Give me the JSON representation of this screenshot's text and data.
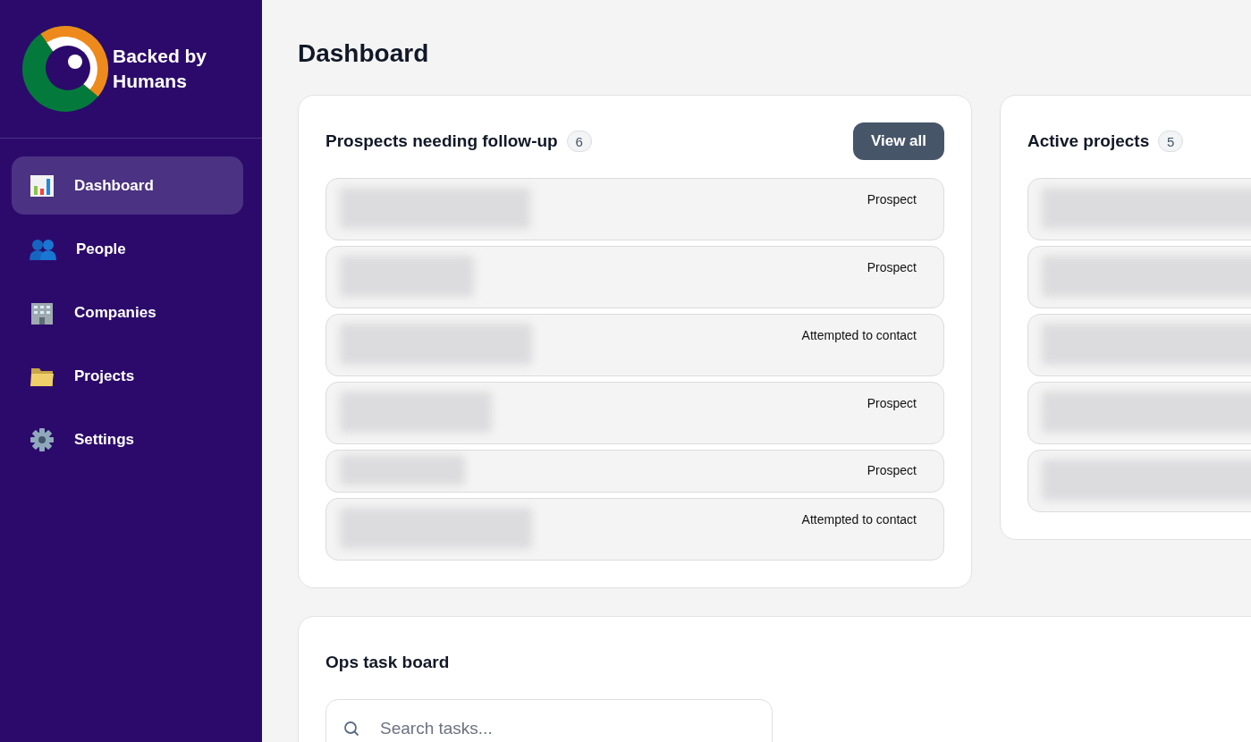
{
  "sidebar": {
    "logo_text": "Backed by Humans",
    "items": [
      {
        "label": "Dashboard",
        "kind": "chart",
        "selected": true
      },
      {
        "label": "People",
        "kind": "people",
        "selected": false
      },
      {
        "label": "Companies",
        "kind": "building",
        "selected": false
      },
      {
        "label": "Projects",
        "kind": "folder",
        "selected": false
      },
      {
        "label": "Settings",
        "kind": "gear",
        "selected": false
      }
    ]
  },
  "page_title": "Dashboard",
  "prospects": {
    "title": "Prospects needing follow-up",
    "count": "6",
    "button": "View all",
    "rows": [
      {
        "kind": "redacted",
        "status": "Prospect"
      },
      {
        "kind": "redacted",
        "status": "Prospect"
      },
      {
        "kind": "redacted",
        "status": "Attempted to contact"
      },
      {
        "kind": "redacted",
        "status": "Prospect"
      },
      {
        "kind": "redacted",
        "status": "Prospect"
      },
      {
        "kind": "redacted",
        "status": "Attempted to contact"
      }
    ]
  },
  "active_projects": {
    "title": "Active projects",
    "count": "5",
    "rows": [
      {
        "kind": "redacted"
      },
      {
        "kind": "redacted"
      },
      {
        "kind": "redacted"
      },
      {
        "kind": "redacted"
      },
      {
        "kind": "redacted"
      }
    ]
  },
  "ops_board": {
    "title": "Ops task board",
    "search": {
      "placeholder": "Search tasks..."
    }
  }
}
